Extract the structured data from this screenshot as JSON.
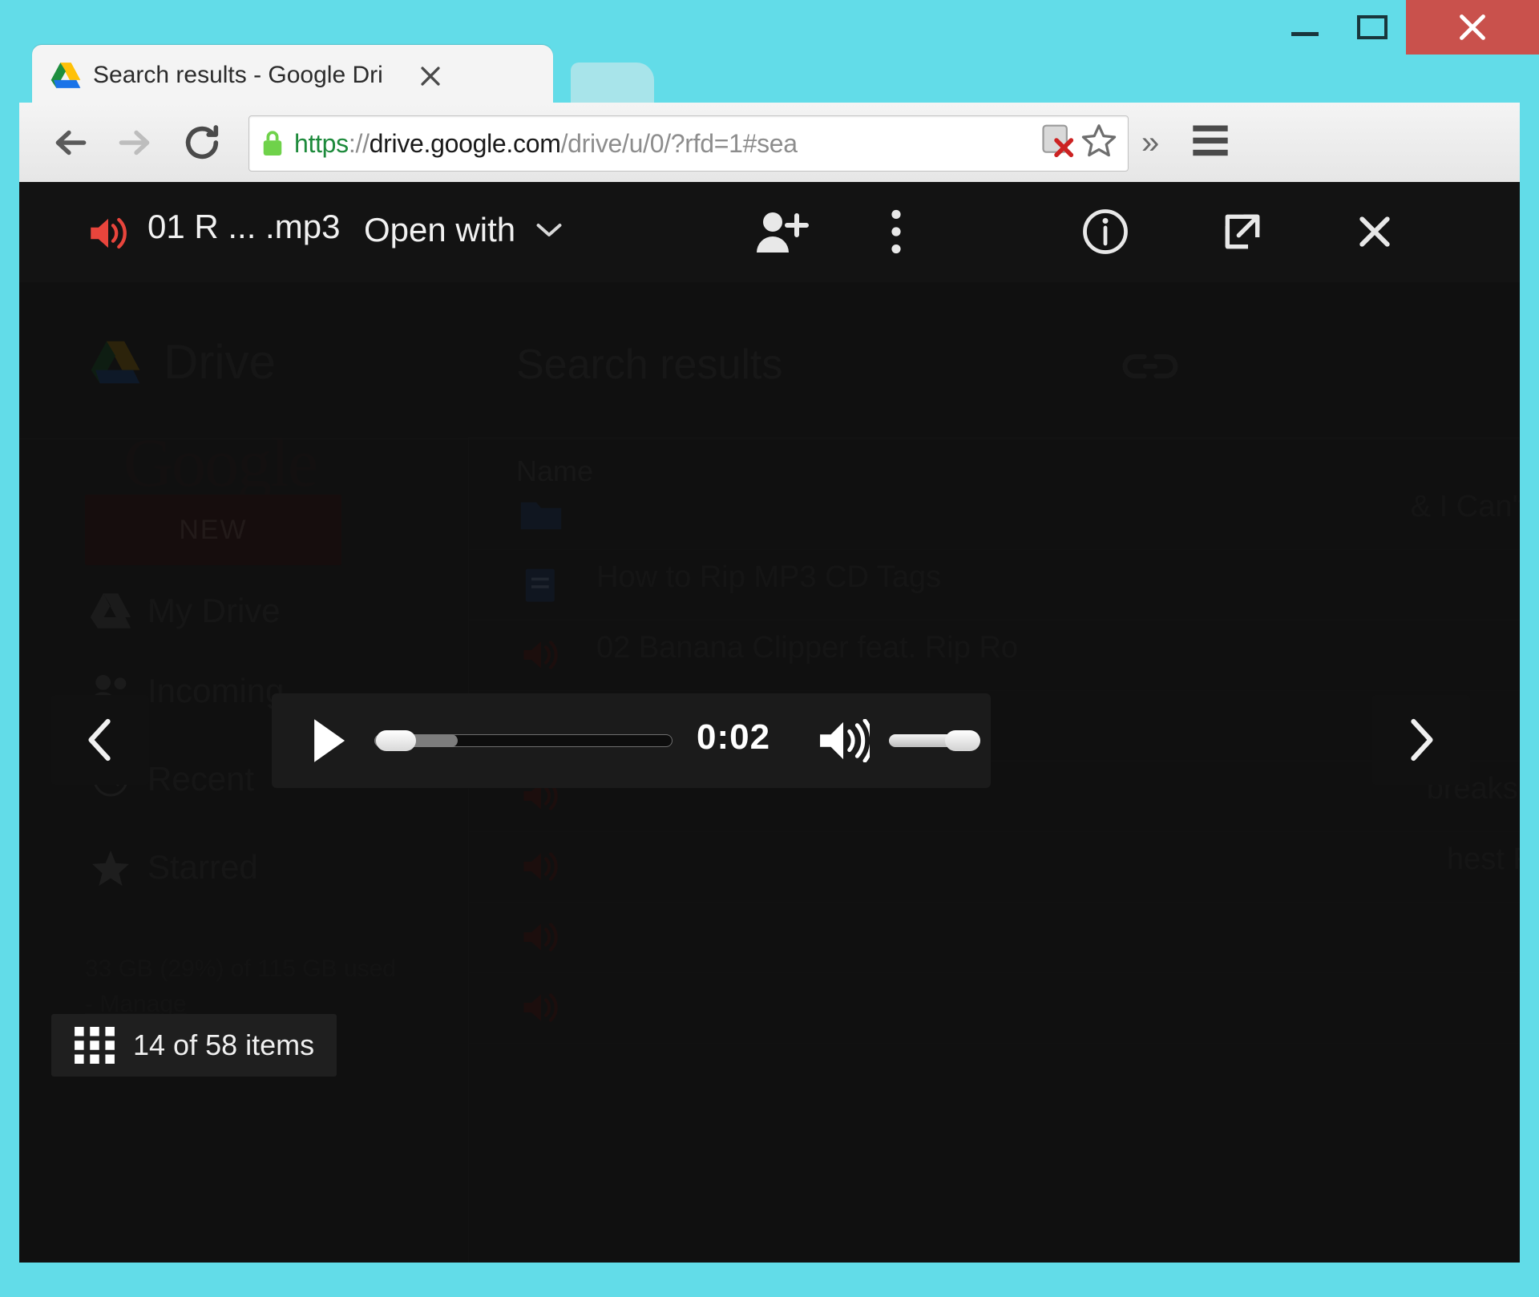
{
  "window": {
    "minimize_label": "Minimize",
    "maximize_label": "Maximize",
    "close_label": "Close",
    "titlebar_color": "#62dce8",
    "close_button_color": "#c9514c"
  },
  "browser": {
    "tab": {
      "title": "Search results - Google Dri",
      "favicon": "google-drive-icon",
      "close_label": "×"
    },
    "new_tab_label": "+",
    "toolbar": {
      "back_label": "Back",
      "forward_label": "Forward",
      "reload_label": "Reload",
      "overflow_label": "»",
      "menu_label": "Menu"
    },
    "omnibox": {
      "scheme": "https",
      "separator": "://",
      "host": "drive.google.com",
      "path": "/drive/u/0/?rfd=1#sea",
      "full_url": "https://drive.google.com/drive/u/0/?rfd=1#sea",
      "lock_icon": "secure-lock-icon"
    }
  },
  "viewer": {
    "file_name": "01 R ... .mp3",
    "audio_icon": "audio-file-icon",
    "open_with_label": "Open with",
    "chevron_icon": "chevron-down-icon",
    "actions": [
      {
        "name": "add-person",
        "icon": "add-person-icon"
      },
      {
        "name": "more",
        "icon": "more-vertical-icon"
      },
      {
        "name": "info",
        "icon": "info-circle-icon"
      },
      {
        "name": "popout",
        "icon": "pop-out-icon"
      },
      {
        "name": "close",
        "icon": "close-icon"
      }
    ],
    "prev_label": "‹",
    "next_label": "›",
    "items_badge": {
      "icon": "grid-view-icon",
      "text": "14 of 58 items",
      "current": 14,
      "total": 58
    },
    "player": {
      "play_icon": "play-icon",
      "current_time": "0:02",
      "progress_percent": 4,
      "buffered_percent": 28,
      "volume_icon": "volume-high-icon",
      "volume_percent": 100
    }
  },
  "drive": {
    "watermark": "Google",
    "logo_icon": "google-drive-icon",
    "wordmark": "Drive",
    "page_title": "Search results",
    "link_icon": "link-icon",
    "new_button": "NEW",
    "sidebar": [
      {
        "label": "My Drive",
        "icon": "drive-icon"
      },
      {
        "label": "Incoming",
        "icon": "people-icon"
      },
      {
        "label": "Recent",
        "icon": "clock-icon"
      },
      {
        "label": "Starred",
        "icon": "star-icon"
      }
    ],
    "storage_used": "33 GB (29%) of 115 GB used",
    "storage_manage": "- Manage",
    "column_header_name": "Name",
    "rows": [
      {
        "icon": "folder-icon",
        "name": "",
        "right": "& I Can't L"
      },
      {
        "icon": "document-icon",
        "name": "How to Rip MP3 CD Tags",
        "right": ""
      },
      {
        "icon": "audio-icon",
        "name": "02 Banana Clipper feat. Rip Ro",
        "right": ""
      },
      {
        "icon": "audio-icon",
        "name": "",
        "right": ""
      },
      {
        "icon": "audio-icon",
        "name": "",
        "right": "breaks.m"
      },
      {
        "icon": "audio-icon",
        "name": "",
        "right": "hest Ro"
      },
      {
        "icon": "audio-icon",
        "name": "",
        "right": ""
      },
      {
        "icon": "audio-icon",
        "name": "",
        "right": ""
      }
    ]
  }
}
